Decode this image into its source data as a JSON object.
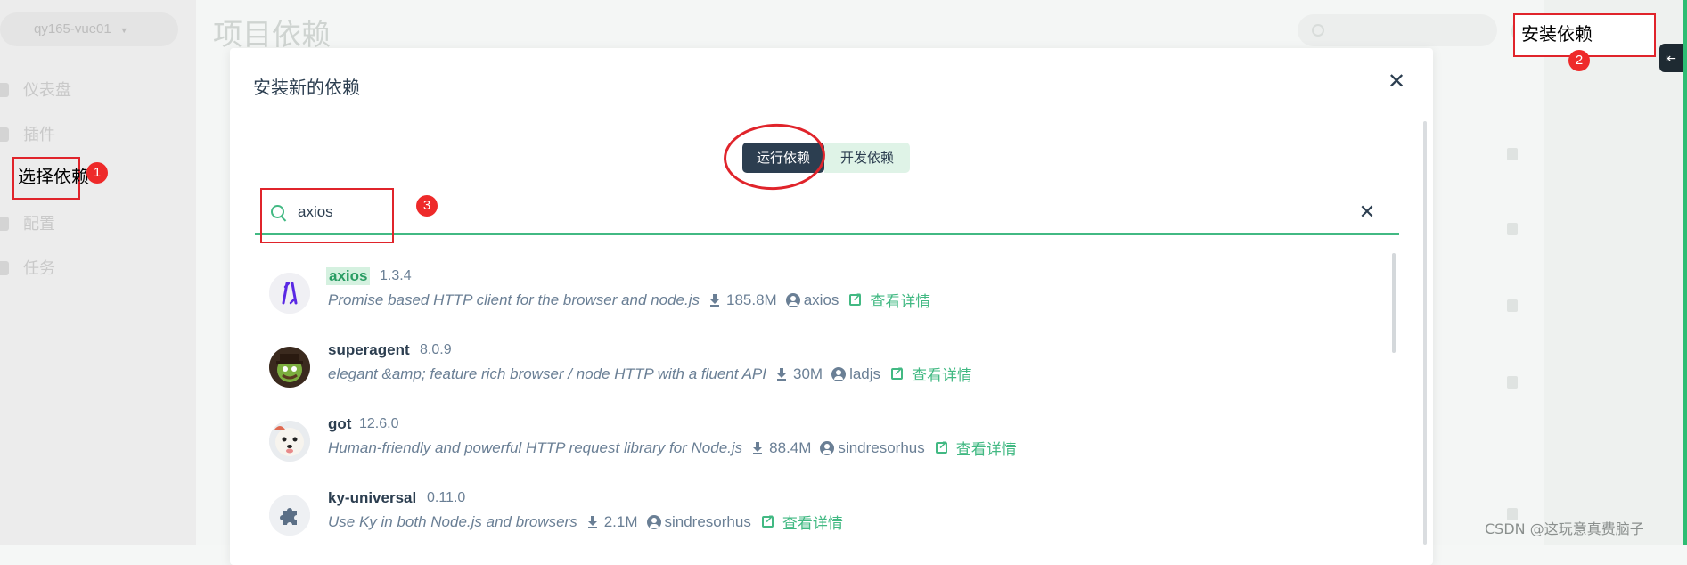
{
  "background": {
    "project_selector": "qy165-vue01",
    "page_title": "项目依赖",
    "nav": [
      "仪表盘",
      "插件",
      "依赖",
      "配置",
      "任务"
    ]
  },
  "annotations": {
    "select_deps": {
      "label": "选择依赖",
      "number": "1"
    },
    "install_deps": {
      "label": "安装依赖",
      "number": "2"
    },
    "search": {
      "number": "3"
    }
  },
  "modal": {
    "title": "安装新的依赖",
    "close_icon": "close-icon",
    "tabs": [
      {
        "label": "运行依赖",
        "active": true
      },
      {
        "label": "开发依赖",
        "active": false
      }
    ],
    "search": {
      "value": "axios",
      "placeholder": ""
    },
    "results": [
      {
        "name": "axios",
        "version": "1.3.4",
        "description": "Promise based HTTP client for the browser and node.js",
        "downloads": "185.8M",
        "author": "axios",
        "details": "查看详情",
        "highlight": true,
        "icon": "axios-logo-icon"
      },
      {
        "name": "superagent",
        "version": "8.0.9",
        "description": "elegant &amp; feature rich browser / node HTTP with a fluent API",
        "downloads": "30M",
        "author": "ladjs",
        "details": "查看详情",
        "highlight": false,
        "icon": "superagent-avatar-icon"
      },
      {
        "name": "got",
        "version": "12.6.0",
        "description": "Human-friendly and powerful HTTP request library for Node.js",
        "downloads": "88.4M",
        "author": "sindresorhus",
        "details": "查看详情",
        "highlight": false,
        "icon": "dog-avatar-icon"
      },
      {
        "name": "ky-universal",
        "version": "0.11.0",
        "description": "Use Ky in both Node.js and browsers",
        "downloads": "2.1M",
        "author": "sindresorhus",
        "details": "查看详情",
        "highlight": false,
        "icon": "puzzle-icon"
      }
    ]
  },
  "watermark": "CSDN @这玩意真费脑子",
  "colors": {
    "accent": "#42b983",
    "dark": "#2c3e50",
    "annotation": "#e0242b"
  }
}
